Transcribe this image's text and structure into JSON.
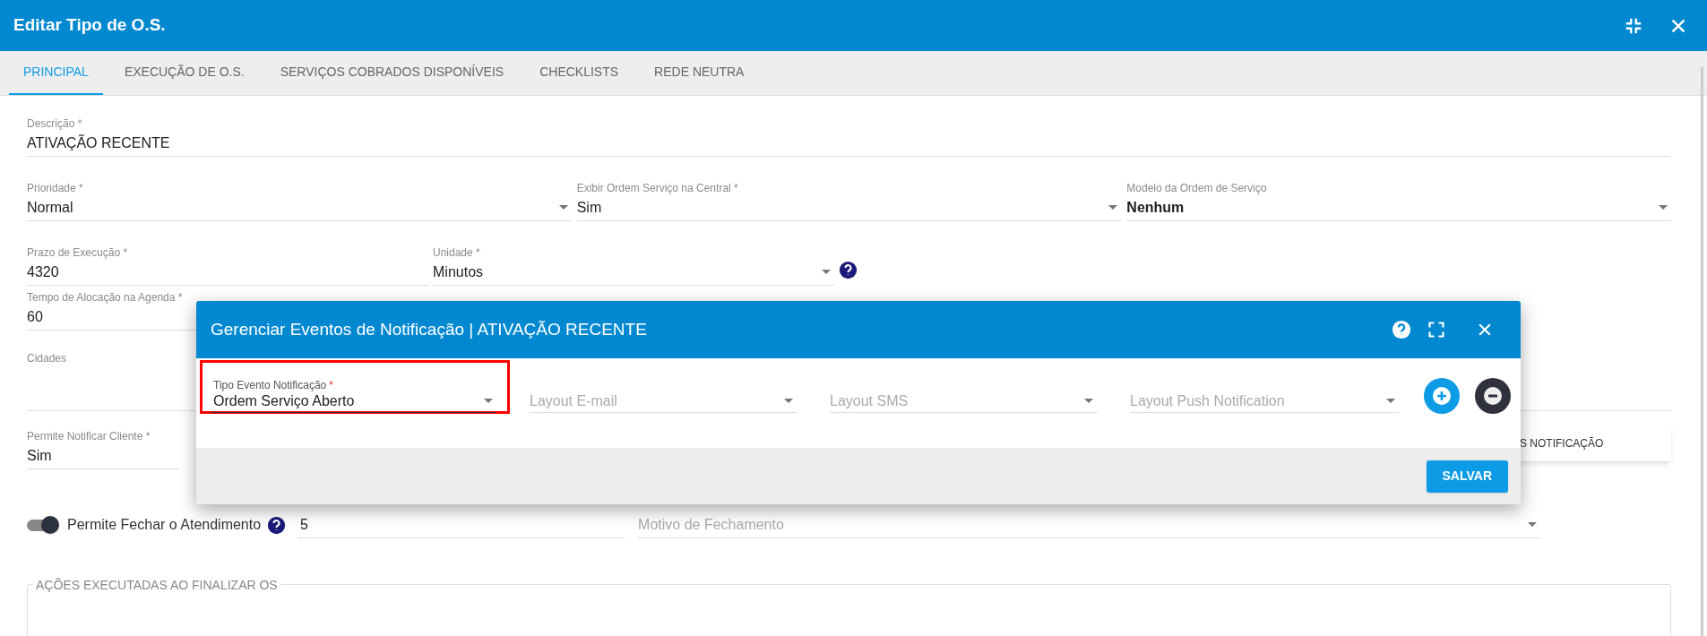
{
  "window": {
    "title": "Editar Tipo de O.S."
  },
  "tabs": [
    {
      "label": "PRINCIPAL",
      "selected": true
    },
    {
      "label": "EXECUÇÃO DE O.S.",
      "selected": false
    },
    {
      "label": "SERVIÇOS COBRADOS DISPONÍVEIS",
      "selected": false
    },
    {
      "label": "CHECKLISTS",
      "selected": false
    },
    {
      "label": "REDE NEUTRA",
      "selected": false
    }
  ],
  "form_rows": [
    {
      "fields": [
        {
          "kind": "text",
          "label": "Descrição",
          "mark": "*",
          "value": "ATIVAÇÃO RECENTE",
          "bold": false
        }
      ]
    },
    {
      "fields": [
        {
          "kind": "select",
          "label": "Prioridade",
          "mark": "*",
          "value": "Normal",
          "bold": false
        },
        {
          "kind": "select",
          "label": "Exibir Ordem Serviço na Central",
          "mark": "*",
          "value": "Sim",
          "bold": false
        },
        {
          "kind": "select",
          "label": "Modelo da Ordem de Serviço",
          "value": "Nenhum",
          "bold": true
        }
      ]
    },
    {
      "fields": [
        {
          "kind": "text",
          "label": "Prazo de Execução",
          "mark": "*",
          "value": "4320",
          "bold": false
        },
        {
          "kind": "select",
          "label": "Unidade",
          "mark": "*",
          "value": "Minutos",
          "bold": false,
          "help": true
        }
      ]
    },
    {
      "fields": [
        {
          "kind": "text",
          "label": "Tempo de Alocação na Agenda",
          "mark": "*",
          "value": "60",
          "bold": false
        }
      ]
    },
    {
      "fields": [
        {
          "kind": "text",
          "label": "Cidades"
        }
      ]
    },
    {
      "fields": [
        {
          "kind": "text",
          "label": "Permite Notificar Cliente",
          "mark": "*",
          "value": "Sim",
          "bold": false
        }
      ]
    }
  ],
  "partial_button": "S NOTIFICAÇÃO",
  "close_toggle": {
    "label": "Permite Fechar o Atendimento",
    "on": true,
    "value": "5",
    "reason_placeholder": "Motivo de Fechamento"
  },
  "section": {
    "title": "AÇÕES EXECUTADAS AO FINALIZAR OS"
  },
  "modal": {
    "title": "Gerenciar Eventos de Notificação | ATIVAÇÃO RECENTE",
    "fields": [
      {
        "label": "Tipo Evento Notificação",
        "mark": "*",
        "value": "Ordem Serviço Aberto",
        "highlighted": true
      },
      {
        "placeholder": "Layout E-mail",
        "highlighted": false
      },
      {
        "placeholder": "Layout SMS",
        "highlighted": false
      },
      {
        "placeholder": "Layout Push Notification",
        "highlighted": false
      }
    ],
    "save_button": "SALVAR"
  }
}
